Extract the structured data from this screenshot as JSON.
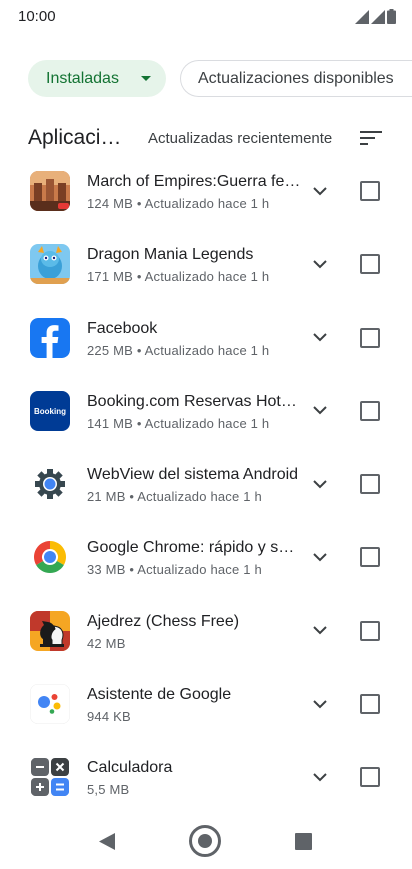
{
  "status_bar": {
    "time": "10:00"
  },
  "filters": {
    "installed_label": "Instaladas",
    "updates_label": "Actualizaciones disponibles"
  },
  "section": {
    "title": "Aplicaci…",
    "sort_label": "Actualizadas recientemente"
  },
  "apps": [
    {
      "name": "March of Empires:Guerra feudal",
      "meta": "124 MB  •  Actualizado hace 1 h",
      "icon": "march-of-empires-icon"
    },
    {
      "name": "Dragon Mania Legends",
      "meta": "171 MB  •  Actualizado hace 1 h",
      "icon": "dragon-mania-icon"
    },
    {
      "name": "Facebook",
      "meta": "225 MB  •  Actualizado hace 1 h",
      "icon": "facebook-icon"
    },
    {
      "name": "Booking.com Reservas Hoteles",
      "meta": "141 MB  •  Actualizado hace 1 h",
      "icon": "booking-icon",
      "icon_text": "Booking"
    },
    {
      "name": "WebView del sistema Android",
      "meta": "21 MB  •  Actualizado hace 1 h",
      "icon": "webview-gear-icon"
    },
    {
      "name": "Google Chrome: rápido y seguro",
      "meta": "33 MB  •  Actualizado hace 1 h",
      "icon": "chrome-icon"
    },
    {
      "name": "Ajedrez (Chess Free)",
      "meta": "42 MB",
      "icon": "chess-icon"
    },
    {
      "name": "Asistente de Google",
      "meta": "944 KB",
      "icon": "google-assistant-icon"
    },
    {
      "name": "Calculadora",
      "meta": "5,5 MB",
      "icon": "calculator-icon"
    }
  ]
}
